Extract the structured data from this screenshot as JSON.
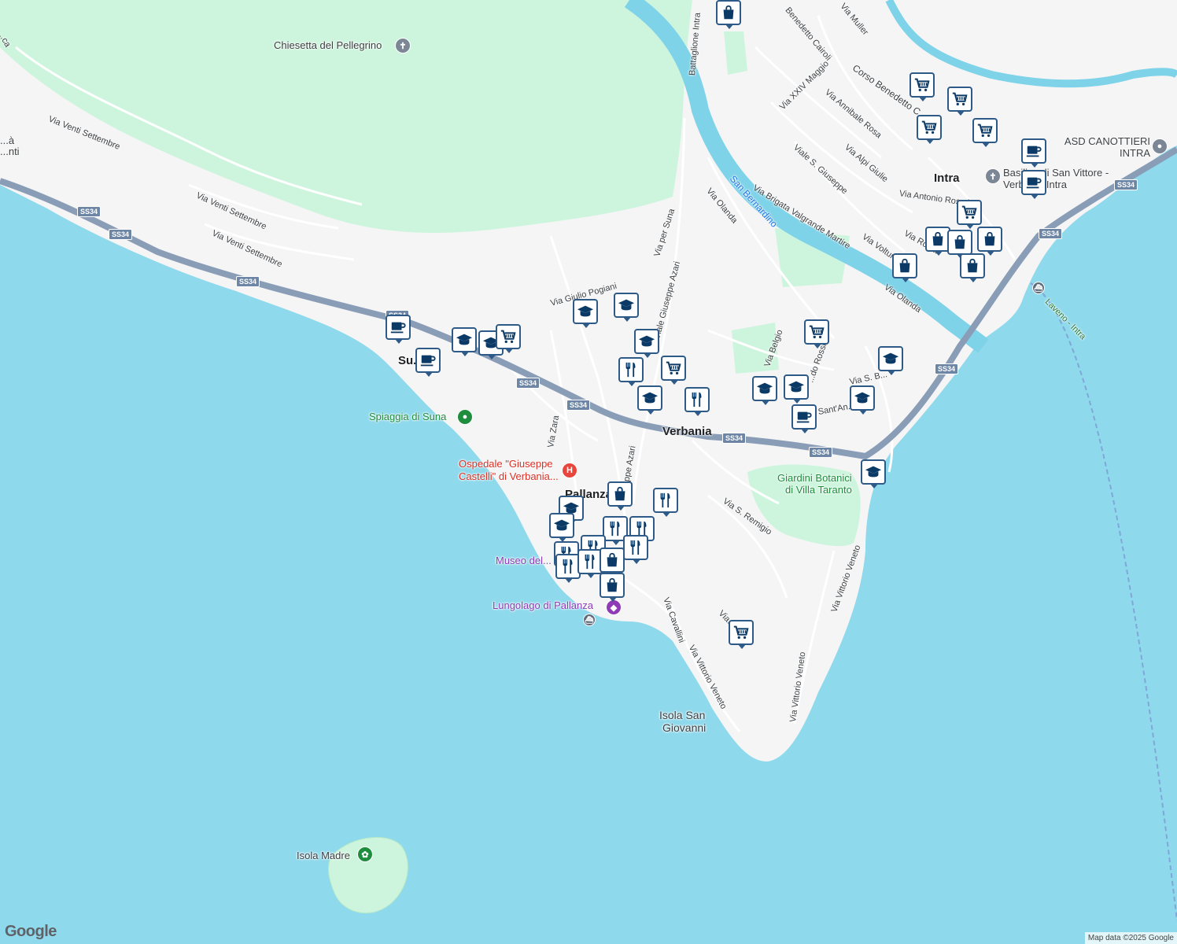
{
  "map": {
    "attribution": "Map data ©2025 Google",
    "logo": "Google",
    "colors": {
      "water": "#8fd9ec",
      "land": "#f5f5f6",
      "park": "#cdf5dd",
      "road": "#ffffff",
      "highway": "#8a9db7",
      "river": "#7fd3e8",
      "pin_border": "#2e5a87",
      "pin_glyph": "#0b3a66"
    }
  },
  "labels": [
    {
      "text": "Chiesetta del Pellegrino",
      "cls": "lbl"
    },
    {
      "text": "Via Venti Settembre",
      "cls": "lbl street"
    },
    {
      "text": "Via Venti Settembre",
      "cls": "lbl street"
    },
    {
      "text": "Via Venti Settembre",
      "cls": "lbl street"
    },
    {
      "text": "Via Giulio Pogiani",
      "cls": "lbl street"
    },
    {
      "text": "Via per Suna",
      "cls": "lbl street"
    },
    {
      "text": "Viale Giuseppe Azari",
      "cls": "lbl street"
    },
    {
      "text": "Via Olanda",
      "cls": "lbl street"
    },
    {
      "text": "San Bernardino",
      "cls": "lbl water"
    },
    {
      "text": "Via Brigata Valgrande Martire",
      "cls": "lbl street"
    },
    {
      "text": "Via XXIV Maggio",
      "cls": "lbl street"
    },
    {
      "text": "Via Annibale Rosa",
      "cls": "lbl street"
    },
    {
      "text": "Viale S. Giuseppe",
      "cls": "lbl street"
    },
    {
      "text": "Via Alpi Giulie",
      "cls": "lbl street"
    },
    {
      "text": "Corso Benedetto C...",
      "cls": "lbl street"
    },
    {
      "text": "Benedetto Cairoli",
      "cls": "lbl street"
    },
    {
      "text": "Via Muller",
      "cls": "lbl street"
    },
    {
      "text": "Battaglione Intra",
      "cls": "lbl street"
    },
    {
      "text": "Intra",
      "cls": "lbl town"
    },
    {
      "text": "ASD CANOTTIERI INTRA",
      "cls": "lbl"
    },
    {
      "text": "Basilica di San Vittore - Verbania Intra",
      "cls": "lbl"
    },
    {
      "text": "Via Antonio Rosmini",
      "cls": "lbl street"
    },
    {
      "text": "Via Roma",
      "cls": "lbl street"
    },
    {
      "text": "Via Voltur...",
      "cls": "lbl street"
    },
    {
      "text": "Via Olanda",
      "cls": "lbl street"
    },
    {
      "text": "Laveno - Intra",
      "cls": "lbl water"
    },
    {
      "text": "Via Belgio",
      "cls": "lbl street"
    },
    {
      "text": "...do Rossi",
      "cls": "lbl street"
    },
    {
      "text": "Via S. B...",
      "cls": "lbl street"
    },
    {
      "text": "Sant'An...",
      "cls": "lbl street"
    },
    {
      "text": "Verbania",
      "cls": "lbl town"
    },
    {
      "text": "Su...",
      "cls": "lbl town"
    },
    {
      "text": "Spiaggia di Suna",
      "cls": "lbl poi-green"
    },
    {
      "text": "Via Zara",
      "cls": "lbl street"
    },
    {
      "text": "Ospedale \"Giuseppe",
      "cls": "lbl poi-red"
    },
    {
      "text": "Castelli\" di Verbania...",
      "cls": "lbl poi-red"
    },
    {
      "text": "Pallanza",
      "cls": "lbl town"
    },
    {
      "text": "...ppe Azari",
      "cls": "lbl street"
    },
    {
      "text": "Via S. Remigio",
      "cls": "lbl street"
    },
    {
      "text": "Giardini Botanici",
      "cls": "lbl poi-green"
    },
    {
      "text": "di Villa Taranto",
      "cls": "lbl poi-green"
    },
    {
      "text": "Museo del...",
      "cls": "lbl poi-purple"
    },
    {
      "text": "Lungolago di Pallanza",
      "cls": "lbl poi-purple"
    },
    {
      "text": "Via Cavallini",
      "cls": "lbl street"
    },
    {
      "text": "Via Vittorio Veneto",
      "cls": "lbl street"
    },
    {
      "text": "Via Vittorio Veneto",
      "cls": "lbl street"
    },
    {
      "text": "Via Vittorio Veneto",
      "cls": "lbl street"
    },
    {
      "text": "Via...",
      "cls": "lbl street"
    },
    {
      "text": "Isola San",
      "cls": "lbl"
    },
    {
      "text": "Giovanni",
      "cls": "lbl"
    },
    {
      "text": "Isola Madre",
      "cls": "lbl"
    },
    {
      "text": "...à ...nti",
      "cls": "lbl"
    },
    {
      "text": "...ca",
      "cls": "lbl street"
    }
  ],
  "shields": [
    "SS34",
    "SS34",
    "SS34",
    "SS34",
    "SS34",
    "SS34",
    "SS34",
    "SS34",
    "SS34",
    "SS34",
    "SS34"
  ],
  "markers": [
    {
      "type": "shopping"
    },
    {
      "type": "grocery"
    },
    {
      "type": "grocery"
    },
    {
      "type": "grocery"
    },
    {
      "type": "grocery"
    },
    {
      "type": "cafe"
    },
    {
      "type": "cafe"
    },
    {
      "type": "grocery"
    },
    {
      "type": "shopping"
    },
    {
      "type": "shopping"
    },
    {
      "type": "shopping"
    },
    {
      "type": "shopping"
    },
    {
      "type": "shopping"
    },
    {
      "type": "school"
    },
    {
      "type": "school"
    },
    {
      "type": "school"
    },
    {
      "type": "restaurant"
    },
    {
      "type": "grocery"
    },
    {
      "type": "school"
    },
    {
      "type": "restaurant"
    },
    {
      "type": "cafe"
    },
    {
      "type": "cafe"
    },
    {
      "type": "school"
    },
    {
      "type": "school"
    },
    {
      "type": "grocery"
    },
    {
      "type": "grocery"
    },
    {
      "type": "school"
    },
    {
      "type": "school"
    },
    {
      "type": "school"
    },
    {
      "type": "school"
    },
    {
      "type": "cafe"
    },
    {
      "type": "school"
    },
    {
      "type": "shopping"
    },
    {
      "type": "restaurant"
    },
    {
      "type": "school"
    },
    {
      "type": "school"
    },
    {
      "type": "restaurant"
    },
    {
      "type": "restaurant"
    },
    {
      "type": "restaurant"
    },
    {
      "type": "restaurant"
    },
    {
      "type": "restaurant"
    },
    {
      "type": "restaurant"
    },
    {
      "type": "restaurant"
    },
    {
      "type": "shopping"
    },
    {
      "type": "shopping"
    },
    {
      "type": "grocery"
    }
  ],
  "place_icons": [
    {
      "type": "church"
    },
    {
      "type": "church"
    },
    {
      "type": "sport"
    },
    {
      "type": "hospital"
    },
    {
      "type": "park"
    },
    {
      "type": "museum"
    },
    {
      "type": "ferry"
    },
    {
      "type": "ferry"
    },
    {
      "type": "garden"
    }
  ]
}
